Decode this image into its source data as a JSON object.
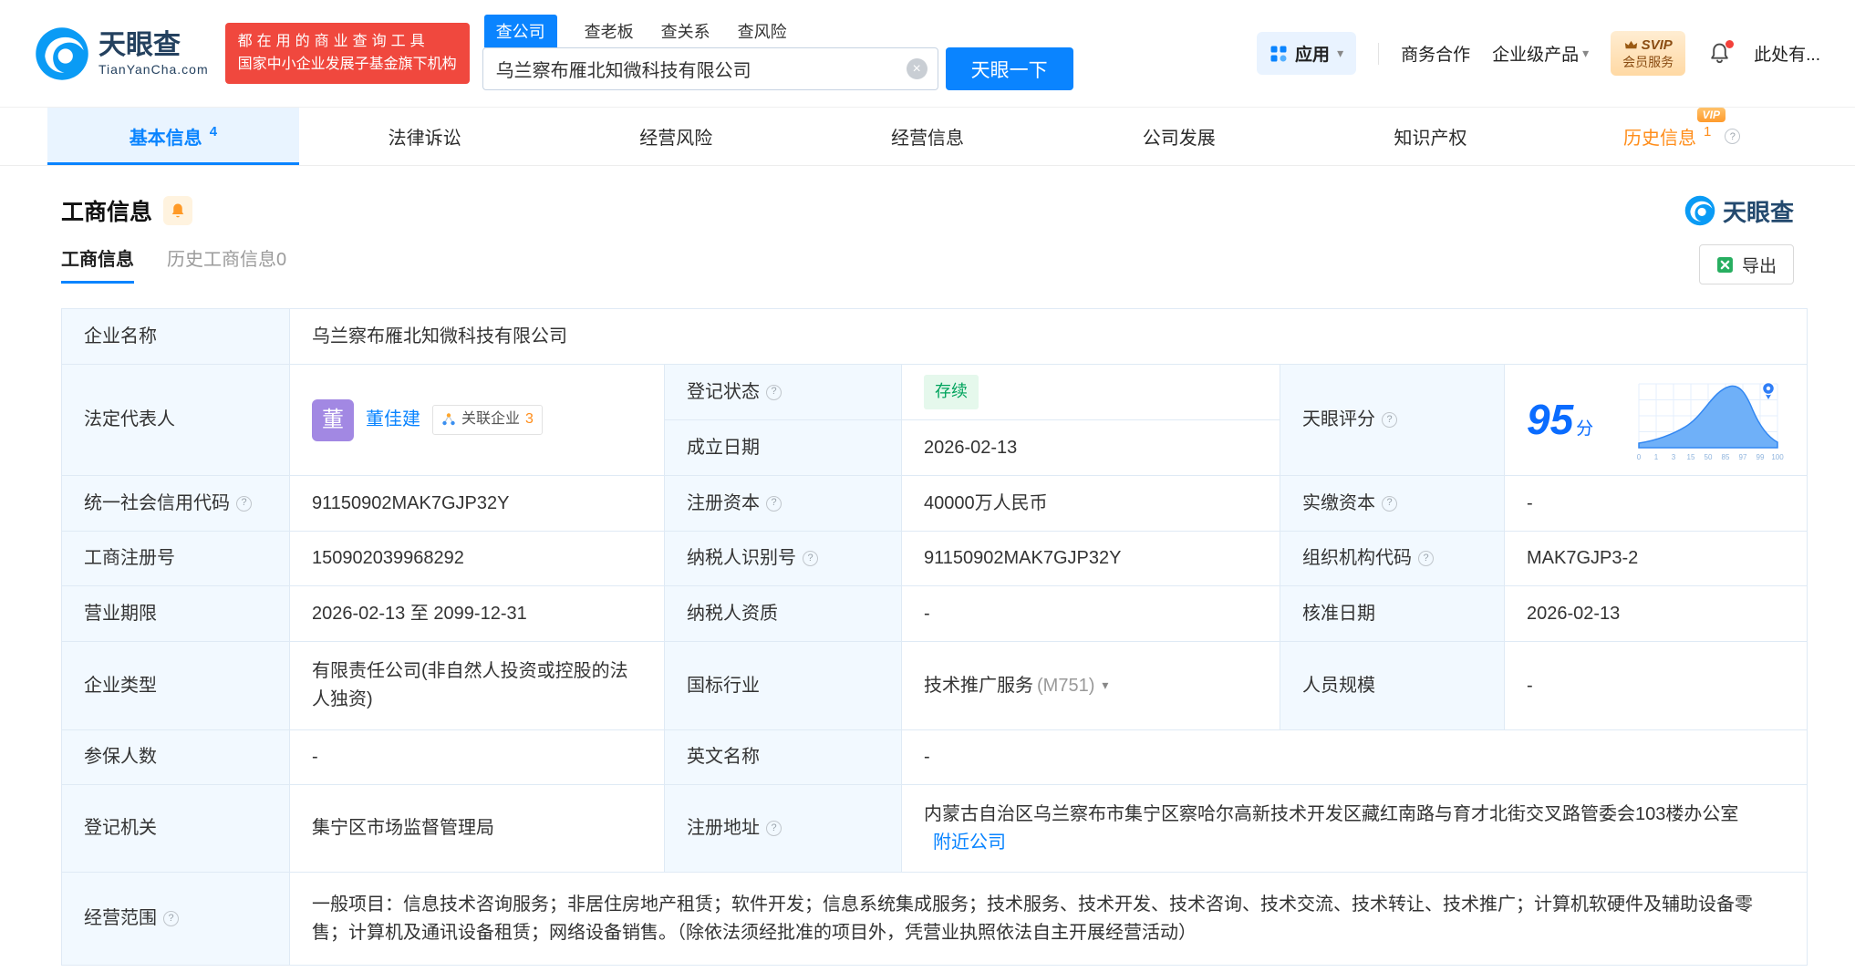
{
  "colors": {
    "brand_blue": "#0a84ff",
    "badge_red": "#f0483e",
    "status_green": "#00a35c",
    "vip_orange": "#ff8d1a",
    "score_blue": "#0a6cff",
    "label_bg": "#f2f9ff"
  },
  "brand": {
    "name": "天眼查",
    "domain": "TianYanCha.com",
    "slogan_line1": "都在用的商业查询工具",
    "slogan_line2": "国家中小企业发展子基金旗下机构",
    "watermark": "天眼查"
  },
  "search": {
    "tabs": [
      {
        "label": "查公司"
      },
      {
        "label": "查老板"
      },
      {
        "label": "查关系"
      },
      {
        "label": "查风险"
      }
    ],
    "value": "乌兰察布雁北知微科技有限公司",
    "button": "天眼一下"
  },
  "header_right": {
    "apps": "应用",
    "cooperation": "商务合作",
    "enterprise": "企业级产品",
    "svip_top": "SVIP",
    "svip_bottom": "会员服务",
    "more": "此处有..."
  },
  "nav": {
    "tabs": [
      {
        "label": "基本信息",
        "count": "4"
      },
      {
        "label": "法律诉讼"
      },
      {
        "label": "经营风险"
      },
      {
        "label": "经营信息"
      },
      {
        "label": "公司发展"
      },
      {
        "label": "知识产权"
      },
      {
        "label": "历史信息",
        "count": "1",
        "vip": "VIP"
      }
    ]
  },
  "section": {
    "title": "工商信息"
  },
  "subtabs": {
    "current": "工商信息",
    "history": "历史工商信息0",
    "export": "导出"
  },
  "table": {
    "company_name_label": "企业名称",
    "company_name": "乌兰察布雁北知微科技有限公司",
    "legal_rep_label": "法定代表人",
    "legal_rep_avatar": "董",
    "legal_rep_name": "董佳建",
    "related_label": "关联企业",
    "related_count": "3",
    "reg_status_label": "登记状态",
    "reg_status": "存续",
    "establish_date_label": "成立日期",
    "establish_date": "2026-02-13",
    "score_label": "天眼评分",
    "score": "95",
    "score_unit": "分",
    "credit_code_label": "统一社会信用代码",
    "credit_code": "91150902MAK7GJP32Y",
    "reg_capital_label": "注册资本",
    "reg_capital": "40000万人民币",
    "paid_capital_label": "实缴资本",
    "paid_capital": "-",
    "reg_number_label": "工商注册号",
    "reg_number": "150902039968292",
    "taxpayer_id_label": "纳税人识别号",
    "taxpayer_id": "91150902MAK7GJP32Y",
    "org_code_label": "组织机构代码",
    "org_code": "MAK7GJP3-2",
    "business_term_label": "营业期限",
    "business_term": "2026-02-13 至 2099-12-31",
    "taxpayer_quali_label": "纳税人资质",
    "taxpayer_quali": "-",
    "approval_date_label": "核准日期",
    "approval_date": "2026-02-13",
    "company_type_label": "企业类型",
    "company_type": "有限责任公司(非自然人投资或控股的法人独资)",
    "industry_label": "国标行业",
    "industry": "技术推广服务",
    "industry_code": "(M751)",
    "staff_size_label": "人员规模",
    "staff_size": "-",
    "insured_label": "参保人数",
    "insured": "-",
    "english_name_label": "英文名称",
    "english_name": "-",
    "reg_authority_label": "登记机关",
    "reg_authority": "集宁区市场监督管理局",
    "reg_address_label": "注册地址",
    "reg_address": "内蒙古自治区乌兰察布市集宁区察哈尔高新技术开发区藏红南路与育才北街交叉路管委会103楼办公室",
    "nearby_link": "附近公司",
    "business_scope_label": "经营范围",
    "business_scope": "一般项目：信息技术咨询服务；非居住房地产租赁；软件开发；信息系统集成服务；技术服务、技术开发、技术咨询、技术交流、技术转让、技术推广；计算机软硬件及辅助设备零售；计算机及通讯设备租赁；网络设备销售。（除依法须经批准的项目外，凭营业执照依法自主开展经营活动）"
  },
  "score_chart": {
    "xticks": [
      "0",
      "1",
      "3",
      "15",
      "50",
      "85",
      "97",
      "99",
      "100"
    ]
  }
}
